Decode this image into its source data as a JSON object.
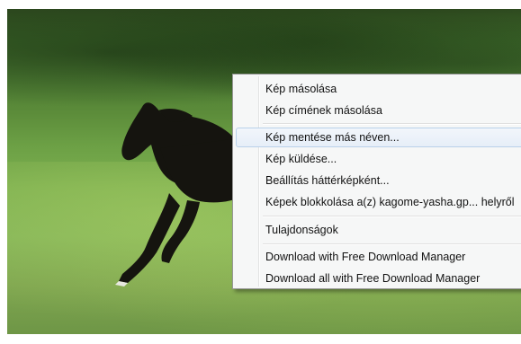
{
  "photo": {
    "description_icon": "horse-photo"
  },
  "context_menu": {
    "items": [
      {
        "label": "Kép másolása"
      },
      {
        "label": "Kép címének másolása"
      },
      {
        "label": "Kép mentése más néven..."
      },
      {
        "label": "Kép küldése..."
      },
      {
        "label": "Beállítás háttérképként..."
      },
      {
        "label": "Képek blokkolása a(z) kagome-yasha.gp... helyről"
      },
      {
        "label": "Tulajdonságok"
      },
      {
        "label": "Download with Free Download Manager"
      },
      {
        "label": "Download all with Free Download Manager"
      }
    ],
    "highlighted_index": 2
  }
}
